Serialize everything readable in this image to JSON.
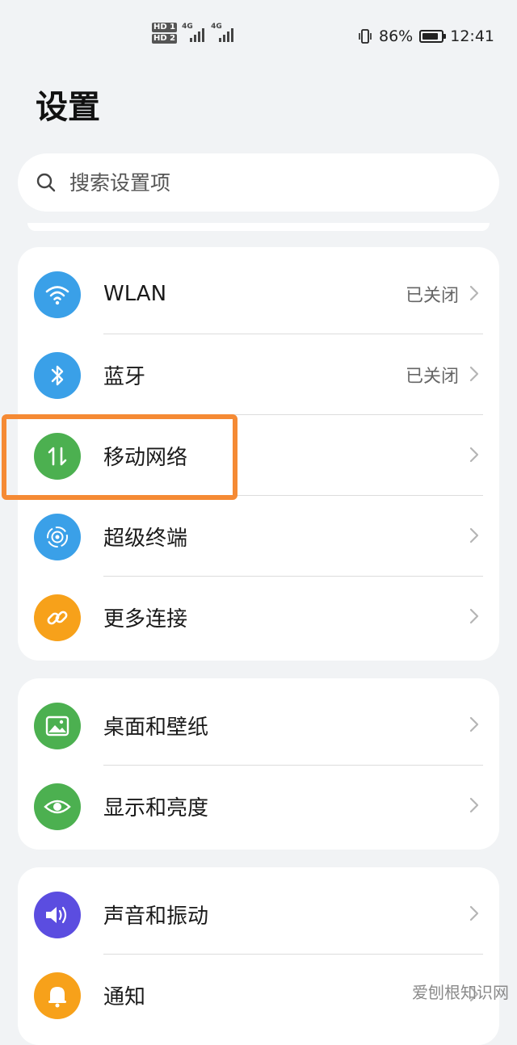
{
  "status_bar": {
    "sim1_badge": "HD 1",
    "sim2_badge": "HD 2",
    "sim1_network": "4G",
    "sim2_network": "4G",
    "battery_percent": "86%",
    "battery_level": 0.86,
    "time": "12:41"
  },
  "header": {
    "title": "设置"
  },
  "search": {
    "placeholder": "搜索设置项",
    "icon": "search-icon"
  },
  "groups": [
    {
      "items": [
        {
          "label": "WLAN",
          "status": "已关闭",
          "icon": "wifi-icon",
          "icon_color": "#3aa0e8"
        },
        {
          "label": "蓝牙",
          "status": "已关闭",
          "icon": "bluetooth-icon",
          "icon_color": "#3aa0e8"
        },
        {
          "label": "移动网络",
          "status": "",
          "icon": "mobile-data-icon",
          "icon_color": "#4cb050"
        },
        {
          "label": "超级终端",
          "status": "",
          "icon": "super-device-icon",
          "icon_color": "#3aa0e8"
        },
        {
          "label": "更多连接",
          "status": "",
          "icon": "link-icon",
          "icon_color": "#f7a11a"
        }
      ]
    },
    {
      "items": [
        {
          "label": "桌面和壁纸",
          "status": "",
          "icon": "wallpaper-icon",
          "icon_color": "#4cb050"
        },
        {
          "label": "显示和亮度",
          "status": "",
          "icon": "eye-icon",
          "icon_color": "#4cb050"
        }
      ]
    },
    {
      "items": [
        {
          "label": "声音和振动",
          "status": "",
          "icon": "speaker-icon",
          "icon_color": "#5b4de0"
        },
        {
          "label": "通知",
          "status": "",
          "icon": "bell-icon",
          "icon_color": "#f7a11a"
        }
      ]
    }
  ],
  "highlight_color": "#f58a34",
  "watermark": "爱刨根知识网"
}
